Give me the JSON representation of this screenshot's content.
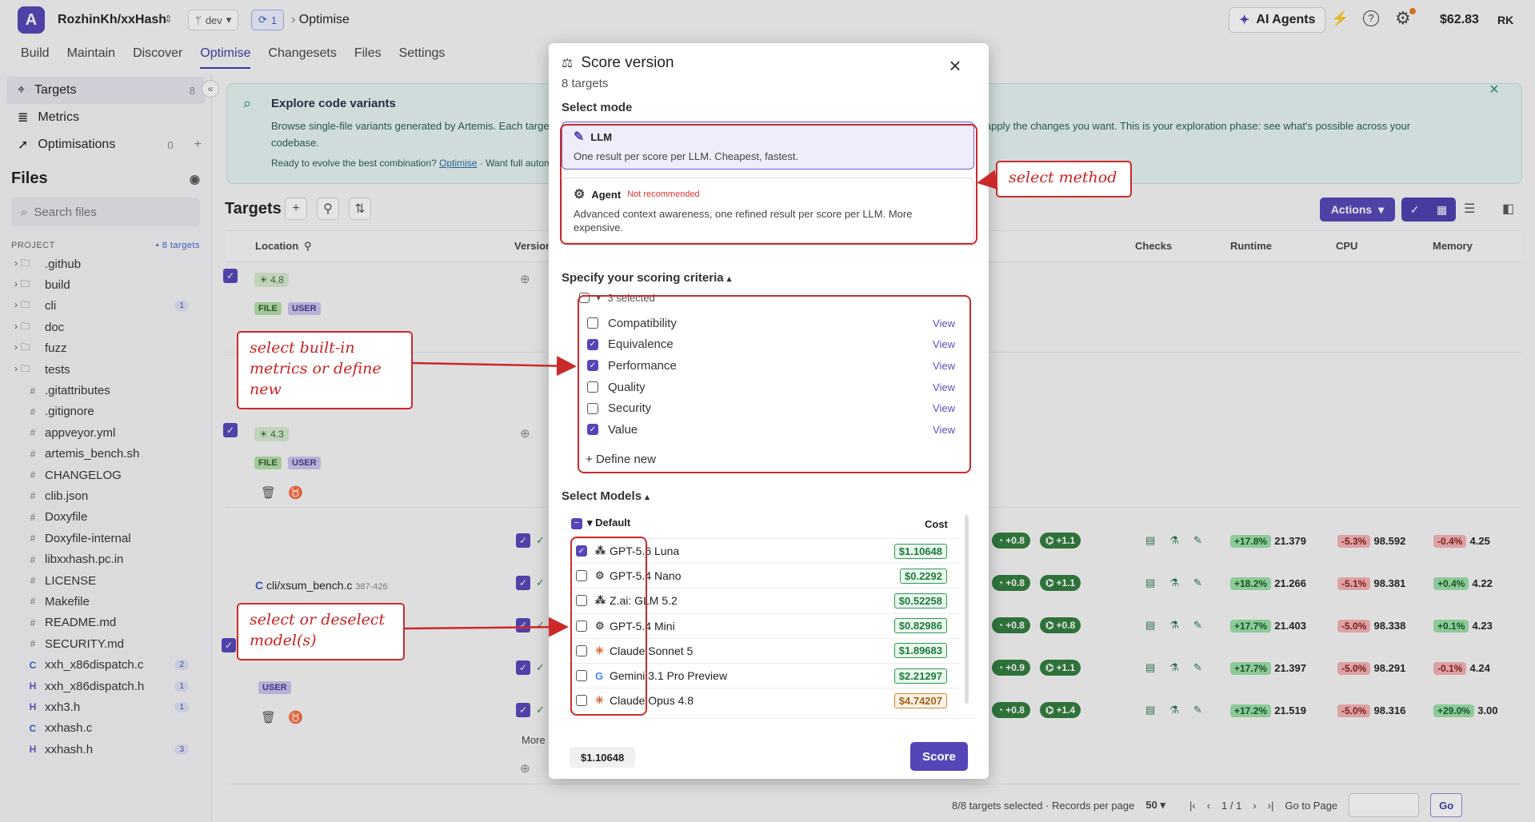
{
  "header": {
    "logo": "A",
    "repo": "RozhinKh/xxHash",
    "branch": "dev",
    "sync_count": "1",
    "breadcrumb": "Optimise",
    "ai_agents": "AI Agents",
    "balance": "$62.83",
    "initials": "RK"
  },
  "nav": [
    "Build",
    "Maintain",
    "Discover",
    "Optimise",
    "Changesets",
    "Files",
    "Settings"
  ],
  "sidebar": {
    "items": [
      {
        "label": "Targets",
        "count": "8"
      },
      {
        "label": "Metrics",
        "count": ""
      },
      {
        "label": "Optimisations",
        "count": "0"
      }
    ],
    "files_title": "Files",
    "search_placeholder": "Search files",
    "project_label": "PROJECT",
    "project_tag": "• 8 targets",
    "tree": [
      {
        "name": ".github",
        "type": "folder",
        "badge": ""
      },
      {
        "name": "build",
        "type": "folder",
        "badge": ""
      },
      {
        "name": "cli",
        "type": "folder",
        "badge": "1"
      },
      {
        "name": "doc",
        "type": "folder",
        "badge": ""
      },
      {
        "name": "fuzz",
        "type": "folder",
        "badge": ""
      },
      {
        "name": "tests",
        "type": "folder",
        "badge": ""
      },
      {
        "name": ".gitattributes",
        "type": "file",
        "badge": ""
      },
      {
        "name": ".gitignore",
        "type": "file",
        "badge": ""
      },
      {
        "name": "appveyor.yml",
        "type": "file",
        "badge": ""
      },
      {
        "name": "artemis_bench.sh",
        "type": "file",
        "badge": ""
      },
      {
        "name": "CHANGELOG",
        "type": "file",
        "badge": ""
      },
      {
        "name": "clib.json",
        "type": "file",
        "badge": ""
      },
      {
        "name": "Doxyfile",
        "type": "file",
        "badge": ""
      },
      {
        "name": "Doxyfile-internal",
        "type": "file",
        "badge": ""
      },
      {
        "name": "libxxhash.pc.in",
        "type": "file",
        "badge": ""
      },
      {
        "name": "LICENSE",
        "type": "file",
        "badge": ""
      },
      {
        "name": "Makefile",
        "type": "file",
        "badge": ""
      },
      {
        "name": "README.md",
        "type": "file",
        "badge": ""
      },
      {
        "name": "SECURITY.md",
        "type": "file",
        "badge": ""
      },
      {
        "name": "xxh_x86dispatch.c",
        "type": "c",
        "badge": "2"
      },
      {
        "name": "xxh_x86dispatch.h",
        "type": "h",
        "badge": "1"
      },
      {
        "name": "xxh3.h",
        "type": "h",
        "badge": "1"
      },
      {
        "name": "xxhash.c",
        "type": "c",
        "badge": ""
      },
      {
        "name": "xxhash.h",
        "type": "h",
        "badge": "3"
      }
    ]
  },
  "banner": {
    "title": "Explore code variants",
    "desc": "Browse single-file variants generated by Artemis. Each targe",
    "desc2": "and apply the changes you want. This is your exploration phase: see what's possible across your",
    "desc3": "codebase.",
    "ready": "Ready to evolve the best combination?",
    "link": "Optimise",
    "ready2": "· Want full autom"
  },
  "targets": {
    "title": "Targets",
    "actions": "Actions",
    "columns": [
      "Location",
      "Version",
      "Checks",
      "Runtime",
      "CPU",
      "Memory"
    ],
    "file_path": "cli/xsum_bench.c",
    "file_lines": "387-426",
    "score1": "4.8",
    "score2": "4.3",
    "tag_file": "FILE",
    "tag_user": "USER",
    "more": "More",
    "rows": [
      {
        "p1": "+0.8",
        "p2": "+1.1",
        "rt": "+17.8%",
        "rtv": "21.379",
        "cpu": "-5.3%",
        "cpuv": "98.592",
        "mem": "-0.4%",
        "memv": "4.25"
      },
      {
        "p1": "+0.8",
        "p2": "+1.1",
        "rt": "+18.2%",
        "rtv": "21.266",
        "cpu": "-5.1%",
        "cpuv": "98.381",
        "mem": "+0.4%",
        "memv": "4.22"
      },
      {
        "p1": "+0.8",
        "p2": "+0.8",
        "rt": "+17.7%",
        "rtv": "21.403",
        "cpu": "-5.0%",
        "cpuv": "98.338",
        "mem": "+0.1%",
        "memv": "4.23"
      },
      {
        "p1": "+0.9",
        "p2": "+1.1",
        "rt": "+17.7%",
        "rtv": "21.397",
        "cpu": "-5.0%",
        "cpuv": "98.291",
        "mem": "-0.1%",
        "memv": "4.24"
      },
      {
        "p1": "+0.8",
        "p2": "+1.4",
        "rt": "+17.2%",
        "rtv": "21.519",
        "cpu": "-5.0%",
        "cpuv": "98.316",
        "mem": "+29.0%",
        "memv": "3.00"
      }
    ],
    "footer": "8/8 targets selected · Records per page",
    "per_page": "50",
    "page": "1 / 1",
    "go_to": "Go to Page",
    "go": "Go"
  },
  "modal": {
    "title": "Score version",
    "subtitle": "8 targets",
    "select_mode": "Select mode",
    "llm": {
      "label": "LLM",
      "desc": "One result per score per LLM. Cheapest, fastest."
    },
    "agent": {
      "label": "Agent",
      "note": "Not recommended",
      "desc": "Advanced context awareness, one refined result per score per LLM. More expensive."
    },
    "criteria_title": "Specify your scoring criteria",
    "selected": "3 selected",
    "criteria": [
      {
        "name": "Compatibility",
        "on": false
      },
      {
        "name": "Equivalence",
        "on": true
      },
      {
        "name": "Performance",
        "on": true
      },
      {
        "name": "Quality",
        "on": false
      },
      {
        "name": "Security",
        "on": false
      },
      {
        "name": "Value",
        "on": true
      }
    ],
    "view": "View",
    "define_new": "Define new",
    "models_title": "Select Models",
    "group": "Default",
    "cost_header": "Cost",
    "models": [
      {
        "name": "GPT-5.6 Luna",
        "cost": "$1.10648",
        "on": true,
        "icon": "network"
      },
      {
        "name": "GPT-5.4 Nano",
        "cost": "$0.2292",
        "on": false,
        "icon": "openai"
      },
      {
        "name": "Z.ai: GLM 5.2",
        "cost": "$0.52258",
        "on": false,
        "icon": "network"
      },
      {
        "name": "GPT-5.4 Mini",
        "cost": "$0.82986",
        "on": false,
        "icon": "openai"
      },
      {
        "name": "Claude Sonnet 5",
        "cost": "$1.89683",
        "on": false,
        "icon": "claude"
      },
      {
        "name": "Gemini 3.1 Pro Preview",
        "cost": "$2.21297",
        "on": false,
        "icon": "google"
      },
      {
        "name": "Claude Opus 4.8",
        "cost": "$4.74207",
        "on": false,
        "icon": "claude",
        "warn": true
      }
    ],
    "total": "$1.10648",
    "score_button": "Score"
  },
  "annotations": {
    "method": "select method",
    "metrics": "select built-in metrics or define new",
    "models": "select or deselect model(s)"
  }
}
